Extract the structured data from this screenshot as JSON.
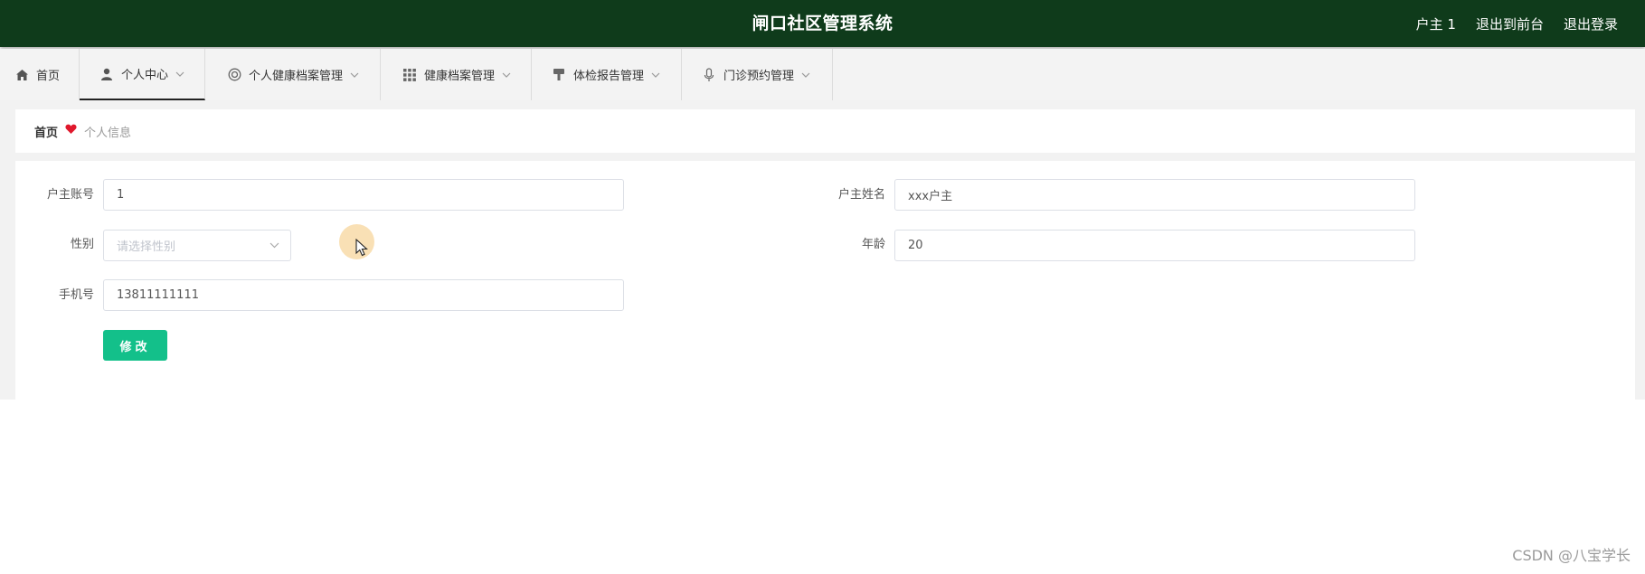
{
  "header": {
    "title": "闸口社区管理系统",
    "user": "户主 1",
    "back_to_front": "退出到前台",
    "logout": "退出登录"
  },
  "nav": {
    "items": [
      {
        "label": "首页",
        "icon": "home-icon",
        "has_dropdown": false,
        "active": false
      },
      {
        "label": "个人中心",
        "icon": "user-icon",
        "has_dropdown": true,
        "active": true
      },
      {
        "label": "个人健康档案管理",
        "icon": "lifebuoy-icon",
        "has_dropdown": true,
        "active": false
      },
      {
        "label": "健康档案管理",
        "icon": "grid-icon",
        "has_dropdown": true,
        "active": false
      },
      {
        "label": "体检报告管理",
        "icon": "brush-icon",
        "has_dropdown": true,
        "active": false
      },
      {
        "label": "门诊预约管理",
        "icon": "microphone-icon",
        "has_dropdown": true,
        "active": false
      }
    ]
  },
  "breadcrumb": {
    "home": "首页",
    "current": "个人信息"
  },
  "form": {
    "account_label": "户主账号",
    "account_value": "1",
    "name_label": "户主姓名",
    "name_value": "xxx户主",
    "gender_label": "性别",
    "gender_placeholder": "请选择性别",
    "age_label": "年龄",
    "age_value": "20",
    "phone_label": "手机号",
    "phone_value": "13811111111",
    "submit_label": "修改"
  },
  "watermark": "CSDN @八宝学长",
  "colors": {
    "header_bg": "#0f3b1b",
    "primary_button": "#13c08a",
    "breadcrumb_heart": "#e0182c"
  }
}
